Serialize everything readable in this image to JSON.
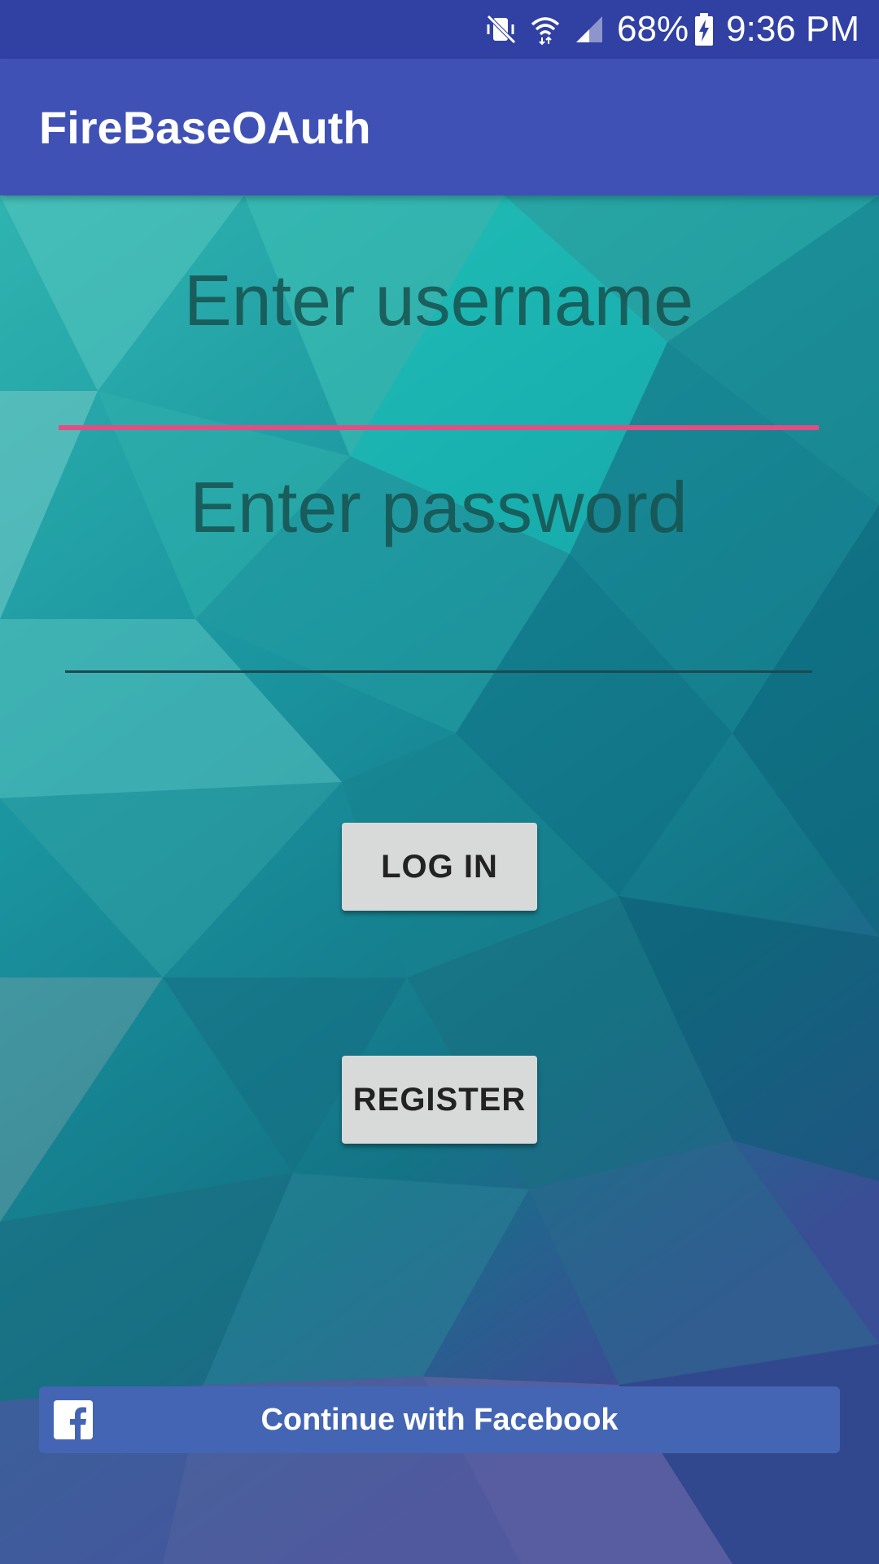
{
  "status_bar": {
    "battery_percent": "68%",
    "time": "9:36 PM",
    "icons": [
      "mute-vibrate-icon",
      "wifi-icon",
      "cellular-signal-icon",
      "battery-charging-icon"
    ]
  },
  "app_bar": {
    "title": "FireBaseOAuth"
  },
  "form": {
    "username": {
      "placeholder": "Enter username",
      "value": ""
    },
    "password": {
      "placeholder": "Enter password",
      "value": ""
    }
  },
  "buttons": {
    "login_label": "LOG IN",
    "register_label": "REGISTER"
  },
  "facebook": {
    "label": "Continue with Facebook",
    "icon": "facebook-f-icon"
  },
  "colors": {
    "status_bar": "#3140a3",
    "app_bar": "#4051b6",
    "username_underline_active": "#e34d84",
    "facebook_blue": "#4365b3",
    "button_gray": "#d8d9d9"
  }
}
